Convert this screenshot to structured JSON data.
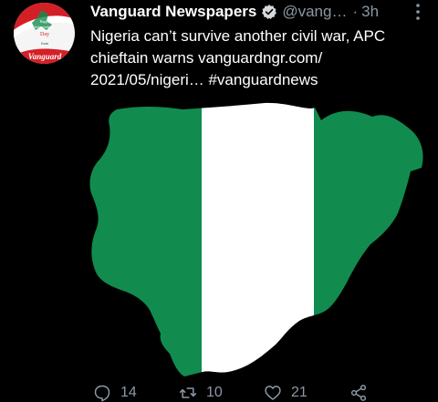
{
  "colors": {
    "background": "#000000",
    "text_primary": "#ffffff",
    "text_secondary": "#8b98a5",
    "nigeria_green": "#118c4e",
    "nigeria_white": "#ffffff"
  },
  "tweet": {
    "avatar": {
      "icon": "vanguard-independence-day-avatar",
      "text_lines": [
        "Happy",
        "Independence",
        "Day",
        "from",
        "Vanguard"
      ]
    },
    "display_name": "Vanguard Newspapers",
    "verified_icon": "verified-badge-icon",
    "handle": "@vang…",
    "separator": "·",
    "time": "3h",
    "more_icon": "more-vertical-icon",
    "text": "Nigeria can’t survive another civil war, APC chieftain warns vanguardngr.com/ 2021/05/nigeri… #vanguardnews",
    "media": {
      "icon": "nigeria-flag-map-image"
    }
  },
  "actions": {
    "reply": {
      "icon": "reply-icon",
      "count": "14"
    },
    "retweet": {
      "icon": "retweet-icon",
      "count": "10"
    },
    "like": {
      "icon": "heart-icon",
      "count": "21"
    },
    "share": {
      "icon": "share-icon"
    }
  }
}
